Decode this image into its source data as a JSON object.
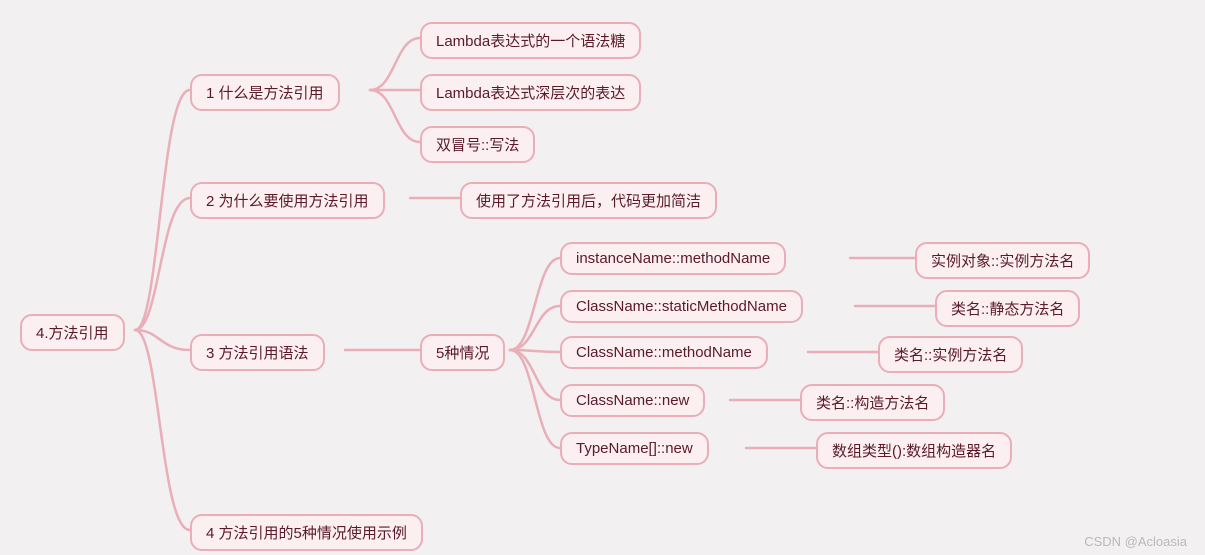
{
  "watermark": "CSDN @Acloasia",
  "root": {
    "label": "4.方法引用"
  },
  "branches": [
    {
      "label": "1 什么是方法引用",
      "children": [
        {
          "label": "Lambda表达式的一个语法糖"
        },
        {
          "label": "Lambda表达式深层次的表达"
        },
        {
          "label": "双冒号::写法"
        }
      ]
    },
    {
      "label": "2 为什么要使用方法引用",
      "children": [
        {
          "label": "使用了方法引用后，代码更加简洁"
        }
      ]
    },
    {
      "label": "3 方法引用语法",
      "mid": {
        "label": "5种情况"
      },
      "children": [
        {
          "label": "instanceName::methodName",
          "desc": "实例对象::实例方法名"
        },
        {
          "label": "ClassName::staticMethodName",
          "desc": "类名::静态方法名"
        },
        {
          "label": "ClassName::methodName",
          "desc": "类名::实例方法名"
        },
        {
          "label": "ClassName::new",
          "desc": "类名::构造方法名"
        },
        {
          "label": "TypeName[]::new",
          "desc": "数组类型():数组构造器名"
        }
      ]
    },
    {
      "label": "4 方法引用的5种情况使用示例"
    }
  ]
}
